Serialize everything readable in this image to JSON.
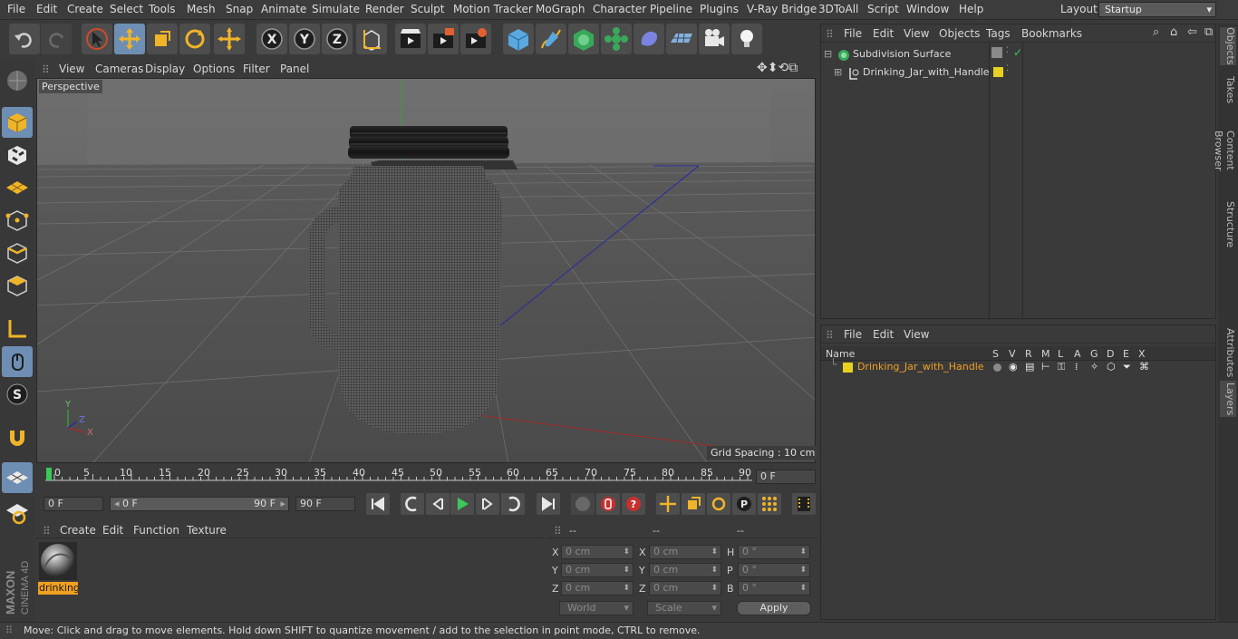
{
  "menu": [
    "File",
    "Edit",
    "Create",
    "Select",
    "Tools",
    "Mesh",
    "Snap",
    "Animate",
    "Simulate",
    "Render",
    "Sculpt",
    "Motion Tracker",
    "MoGraph",
    "Character",
    "Pipeline",
    "Plugins",
    "V-Ray Bridge",
    "3DToAll",
    "Script",
    "Window",
    "Help"
  ],
  "layout": {
    "label": "Layout:",
    "value": "Startup"
  },
  "viewport": {
    "menu": [
      "View",
      "Cameras",
      "Display",
      "Options",
      "Filter",
      "Panel"
    ],
    "label": "Perspective",
    "grid_spacing": "Grid Spacing : 10 cm",
    "axis_y": "Y",
    "axis_z": "Z",
    "axis_x": "X"
  },
  "timeline": {
    "ticks": [
      "0",
      "5",
      "10",
      "15",
      "20",
      "25",
      "30",
      "35",
      "40",
      "45",
      "50",
      "55",
      "60",
      "65",
      "70",
      "75",
      "80",
      "85",
      "90"
    ],
    "current_frame": "0 F",
    "start_field": "0 F",
    "range_start": "0 F",
    "range_end": "90 F",
    "end_field": "90 F"
  },
  "material": {
    "menu": [
      "Create",
      "Edit",
      "Function",
      "Texture"
    ],
    "name": "drinking"
  },
  "coords": {
    "headers": [
      "--",
      "--",
      "--"
    ],
    "rows": [
      {
        "l1": "X",
        "v1": "0 cm",
        "l2": "X",
        "v2": "0 cm",
        "l3": "H",
        "v3": "0 °"
      },
      {
        "l1": "Y",
        "v1": "0 cm",
        "l2": "Y",
        "v2": "0 cm",
        "l3": "P",
        "v3": "0 °"
      },
      {
        "l1": "Z",
        "v1": "0 cm",
        "l2": "Z",
        "v2": "0 cm",
        "l3": "B",
        "v3": "0 °"
      }
    ],
    "world": "World",
    "scale": "Scale",
    "apply": "Apply"
  },
  "objects": {
    "menu": [
      "File",
      "Edit",
      "View",
      "Objects",
      "Tags",
      "Bookmarks"
    ],
    "items": [
      "Subdivision Surface",
      "Drinking_Jar_with_Handle"
    ]
  },
  "layers": {
    "menu": [
      "File",
      "Edit",
      "View"
    ],
    "columns": [
      "Name",
      "S",
      "V",
      "R",
      "M",
      "L",
      "A",
      "G",
      "D",
      "E",
      "X"
    ],
    "row_name": "Drinking_Jar_with_Handle"
  },
  "right_tabs": [
    "Objects",
    "Takes",
    "Content Browser",
    "Structure",
    "Attributes",
    "Layers"
  ],
  "status": "Move: Click and drag to move elements. Hold down SHIFT to quantize movement / add to the selection in point mode, CTRL to remove.",
  "brand": {
    "line1": "MAXON",
    "line2": "CINEMA 4D"
  },
  "colors": {
    "accent": "#6e8fb3",
    "selected_text": "#f0a020",
    "layer_yellow": "#e8d020"
  }
}
